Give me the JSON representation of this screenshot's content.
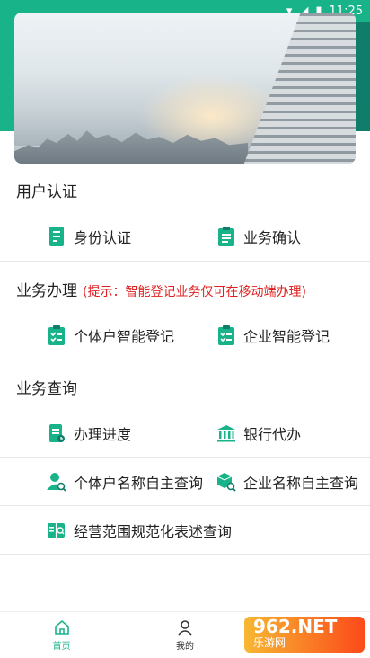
{
  "status_bar": {
    "time": "11:25"
  },
  "sections": {
    "user_auth": {
      "title": "用户认证",
      "items": [
        "身份认证",
        "业务确认"
      ]
    },
    "business": {
      "title": "业务办理",
      "hint": "(提示：智能登记业务仅可在移动端办理)",
      "items": [
        "个体户智能登记",
        "企业智能登记"
      ]
    },
    "query": {
      "title": "业务查询",
      "items": [
        "办理进度",
        "银行代办",
        "个体户名称自主查询",
        "企业名称自主查询",
        "经营范围规范化表述查询"
      ]
    }
  },
  "bottom_nav": {
    "items": [
      "首页",
      "我的"
    ]
  },
  "watermark": {
    "top": "962.NET",
    "bottom": "乐游网"
  },
  "colors": {
    "accent": "#19b38a",
    "hint": "#e02020"
  }
}
